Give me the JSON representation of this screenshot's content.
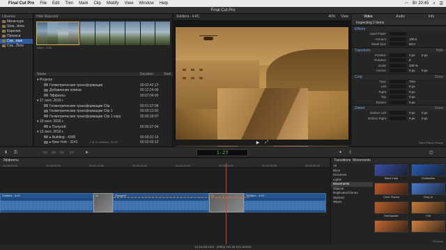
{
  "menubar": {
    "app": "Final Cut Pro",
    "items": [
      "File",
      "Edit",
      "Trim",
      "Mark",
      "Clip",
      "Modify",
      "View",
      "Window",
      "Help"
    ],
    "clock": "Вт 20:45"
  },
  "window_title": "Final Cut Pro",
  "libraries": {
    "header": "Libraries",
    "items": [
      {
        "label": "Мини-курс",
        "selected": false
      },
      {
        "label": "Sma...tions",
        "selected": false
      },
      {
        "label": "Карелия",
        "selected": false
      },
      {
        "label": "Проекси",
        "selected": false
      },
      {
        "label": "Ска...ешн",
        "selected": true
      },
      {
        "label": "Ска...Лети",
        "selected": false
      }
    ]
  },
  "browser": {
    "header": "Hide Rejected",
    "clip_label": "Tokyo - 4:55",
    "columns": {
      "name": "Name",
      "duration": "Duration",
      "start": "Start"
    },
    "rows": [
      {
        "indent": 0,
        "type": "event",
        "label": "▾ Projects",
        "duration": "",
        "expander": ""
      },
      {
        "indent": 1,
        "type": "file",
        "label": "Геометрические трансформации",
        "duration": "00:02:42:13"
      },
      {
        "indent": 1,
        "type": "file",
        "label": "Добавление клипов",
        "duration": "00:12:24:09"
      },
      {
        "indent": 1,
        "type": "file",
        "label": "Эффекты",
        "duration": "00:07:04:09"
      },
      {
        "indent": 0,
        "type": "event",
        "label": "▾ 17 сент. 2016 г.",
        "duration": "",
        "expander": ""
      },
      {
        "indent": 1,
        "type": "file",
        "label": "Геометрические трансформации Clip",
        "duration": "00:01:07:08"
      },
      {
        "indent": 1,
        "type": "file",
        "label": "Геометрические трансформации Clip 1",
        "duration": "00:00:13:00"
      },
      {
        "indent": 1,
        "type": "file",
        "label": "Геометрические трансформации Clip 1 copy",
        "duration": "00:00:18:07"
      },
      {
        "indent": 0,
        "type": "event",
        "label": "▾ 19 сент. 2016 г.",
        "duration": "",
        "expander": ""
      },
      {
        "indent": 1,
        "type": "file",
        "label": "▸ Полусей",
        "duration": "00:00:27:04"
      },
      {
        "indent": 0,
        "type": "event",
        "label": "▾ 13 сент. 2016 г.",
        "duration": "",
        "expander": ""
      },
      {
        "indent": 1,
        "type": "file",
        "label": "▸ Building - 4395",
        "duration": "00:00:31:19"
      },
      {
        "indent": 1,
        "type": "file",
        "label": "▸ New York - 3141",
        "duration": "00:02:02:12"
      }
    ],
    "status": "1 of 11 selected, 07:03"
  },
  "viewer": {
    "clip_name": "Soldiers - 4:4C",
    "zoom": "40%",
    "view_menu": "View"
  },
  "inspector": {
    "tabs": [
      "Video",
      "Audio",
      "Info"
    ],
    "title": "Inspecting 2 items",
    "sections": [
      {
        "name": "Effects",
        "show": "",
        "rows": [
          {
            "label": "Aged Paper",
            "values": [
              "",
              ""
            ]
          },
          {
            "label": "Amount",
            "values": [
              "100.0",
              ""
            ]
          },
          {
            "label": "Mask Size",
            "values": [
              "50.0",
              ""
            ]
          }
        ]
      },
      {
        "name": "Transform",
        "show": "Hide",
        "rows": [
          {
            "label": "Position",
            "values": [
              "0 px",
              "0 px"
            ]
          },
          {
            "label": "Rotation",
            "values": [
              "0",
              ""
            ]
          },
          {
            "label": "Scale",
            "values": [
              "100 %",
              ""
            ]
          },
          {
            "label": "Anchor",
            "values": [
              "0 px",
              "0 px"
            ]
          }
        ]
      },
      {
        "name": "Crop",
        "show": "Show",
        "rows": [
          {
            "label": "Type",
            "values": [
              "Trim",
              ""
            ]
          },
          {
            "label": "Left",
            "values": [
              "0 px",
              ""
            ]
          },
          {
            "label": "Right",
            "values": [
              "0 px",
              ""
            ]
          },
          {
            "label": "Top",
            "values": [
              "0 px",
              ""
            ]
          },
          {
            "label": "Bottom",
            "values": [
              "0 px",
              ""
            ]
          }
        ]
      },
      {
        "name": "Distort",
        "show": "Show",
        "rows": [
          {
            "label": "Bottom Left",
            "values": [
              "0 px",
              "0 px"
            ]
          },
          {
            "label": "Bottom Right",
            "values": [
              "0 px",
              "0 px"
            ]
          }
        ]
      }
    ],
    "save_preset": "Save Effects Preset"
  },
  "toolbar": {
    "timecode": "1:27",
    "import_icon": "download-icon"
  },
  "timeline": {
    "index_label": "Эффекты",
    "ruler_marks": [
      "00:00:00:00",
      "00:00:05:00",
      "00:00:10:00",
      "00:00:15:00",
      "00:00:20:00",
      "00:00:25:00",
      "00:00:30:00",
      "00:00:35:00"
    ],
    "clips": [
      {
        "label": "Soldiers - 4:4C"
      },
      {
        "label": "Полусей"
      },
      {
        "label": "Soldiers - 4:4C"
      }
    ],
    "transitions": [
      {
        "label": "Cr"
      },
      {
        "label": "Cr"
      }
    ],
    "footer": "01:04:09 total - 1080p HD 29.97p Stereo"
  },
  "transitions_browser": {
    "header": "Transitions",
    "sub": "Movements",
    "categories": [
      {
        "label": "All",
        "selected": false
      },
      {
        "label": "Blurs",
        "selected": false
      },
      {
        "label": "Dissolves",
        "selected": false
      },
      {
        "label": "Lights",
        "selected": false
      },
      {
        "label": "Movements",
        "selected": true
      },
      {
        "label": "Objects",
        "selected": false
      },
      {
        "label": "Replicator/Clones",
        "selected": false
      },
      {
        "label": "Stylized",
        "selected": false
      },
      {
        "label": "Wipes",
        "selected": false
      }
    ],
    "items": [
      {
        "label": "Black Hole",
        "color": "#3a4fa8"
      },
      {
        "label": "Clothesline",
        "color": "#2a5bb5"
      },
      {
        "label": "Color Planes",
        "color": "#c05a2a"
      },
      {
        "label": "Drop In",
        "color": "#4a7ad0"
      },
      {
        "label": "Earthquake",
        "color": "#b8602a"
      },
      {
        "label": "Fall",
        "color": "#c87a3a"
      },
      {
        "label": "",
        "color": "#c46a30"
      },
      {
        "label": "",
        "color": "#d08040"
      }
    ],
    "count": "25 Items"
  }
}
